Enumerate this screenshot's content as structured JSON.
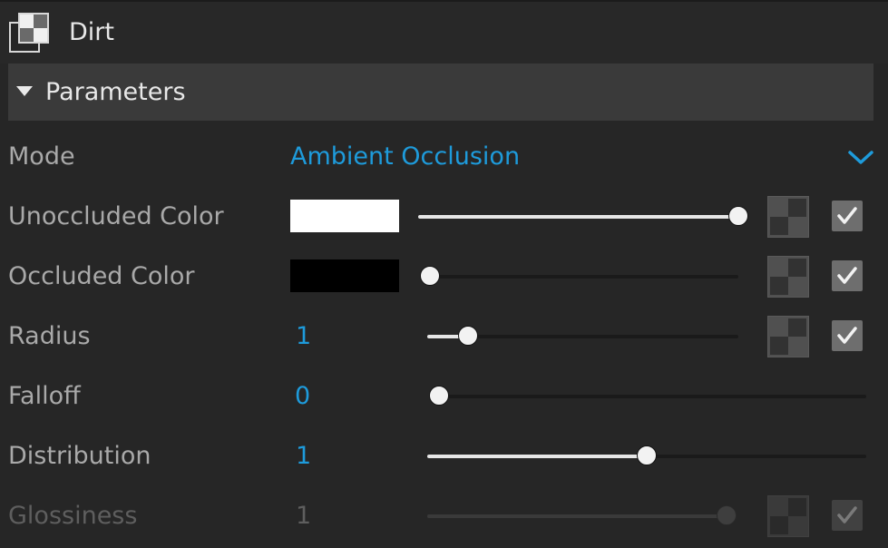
{
  "titlebar": {
    "title": "Dirt",
    "icon": "texture-layers-icon"
  },
  "section": {
    "title": "Parameters",
    "expanded": true,
    "icon": "triangle-down-icon"
  },
  "colors": {
    "accent": "#1e9bdb",
    "label": "#a9a9a9",
    "disabled": "#5e5e5e"
  },
  "params": {
    "mode": {
      "label": "Mode",
      "value": "Ambient Occlusion",
      "icon": "chevron-down-icon"
    },
    "unoccluded_color": {
      "label": "Unoccluded Color",
      "swatch": "#ffffff",
      "slider_fraction": 1.0,
      "texture_enabled": true
    },
    "occluded_color": {
      "label": "Occluded Color",
      "swatch": "#000000",
      "slider_fraction": 0.0,
      "texture_enabled": true
    },
    "radius": {
      "label": "Radius",
      "value": "1",
      "slider_fraction": 0.13,
      "texture_enabled": true
    },
    "falloff": {
      "label": "Falloff",
      "value": "0",
      "slider_fraction": 0.0
    },
    "distribution": {
      "label": "Distribution",
      "value": "1",
      "slider_fraction": 0.5
    },
    "glossiness": {
      "label": "Glossiness",
      "value": "1",
      "slider_fraction": 1.0,
      "texture_enabled": true,
      "disabled": true
    }
  }
}
